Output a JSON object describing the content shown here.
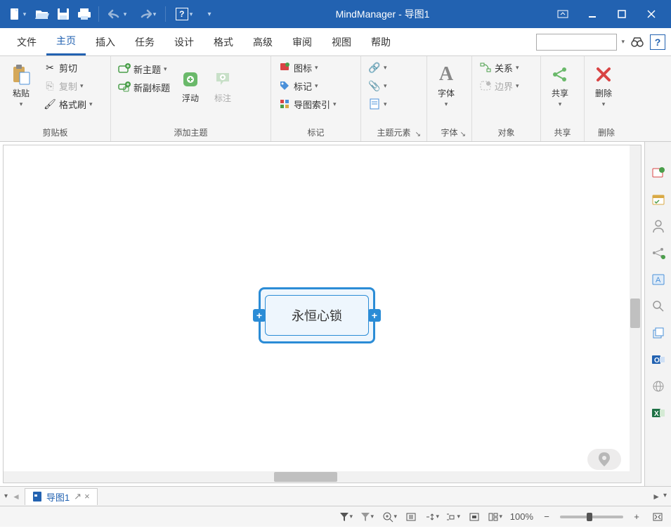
{
  "app_title": "MindManager - 导图1",
  "menu_tabs": [
    "文件",
    "主页",
    "插入",
    "任务",
    "设计",
    "格式",
    "高级",
    "审阅",
    "视图",
    "帮助"
  ],
  "active_tab_index": 1,
  "ribbon": {
    "clipboard": {
      "paste": "粘贴",
      "cut": "剪切",
      "copy": "复制",
      "format": "格式刷",
      "group": "剪贴板"
    },
    "add": {
      "new_topic": "新主题",
      "new_subtopic": "新副标题",
      "float": "浮动",
      "callout": "标注",
      "group": "添加主题"
    },
    "marker": {
      "icon": "图标",
      "tag": "标记",
      "index": "导图索引",
      "group": "标记"
    },
    "elements": {
      "group": "主题元素"
    },
    "font": {
      "label": "字体",
      "group": "字体"
    },
    "object": {
      "relation": "关系",
      "boundary": "边界",
      "group": "对象"
    },
    "share": {
      "label": "共享",
      "group": "共享"
    },
    "delete": {
      "label": "删除",
      "group": "删除"
    }
  },
  "topic_text": "永恒心锁",
  "doc_tab": "导图1",
  "zoom": "100%"
}
